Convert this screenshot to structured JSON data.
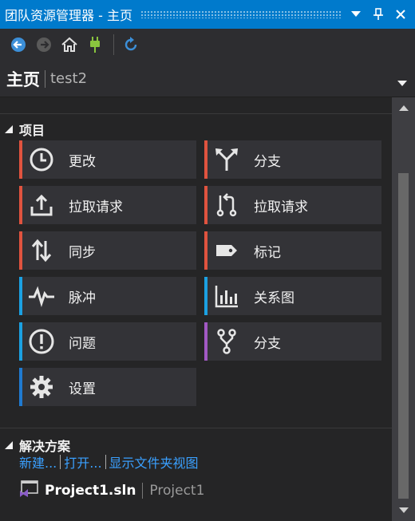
{
  "window": {
    "title": "团队资源管理器 - 主页"
  },
  "toolbar": {
    "back": "back-arrow-icon",
    "forward": "forward-arrow-icon",
    "home": "home-icon",
    "connect": "plug-icon",
    "refresh": "refresh-icon"
  },
  "header": {
    "title": "主页",
    "subtitle": "test2"
  },
  "project_section": {
    "title": "项目",
    "tiles": [
      {
        "label": "更改",
        "icon": "clock-icon",
        "bar_color": "#e0533f"
      },
      {
        "label": "分支",
        "icon": "branch-icon",
        "bar_color": "#e0533f"
      },
      {
        "label": "拉取请求",
        "icon": "upload-tray-icon",
        "bar_color": "#e0533f"
      },
      {
        "label": "拉取请求",
        "icon": "pull-request-icon",
        "bar_color": "#e0533f"
      },
      {
        "label": "同步",
        "icon": "sync-arrows-icon",
        "bar_color": "#e0533f"
      },
      {
        "label": "标记",
        "icon": "tag-icon",
        "bar_color": "#e0533f"
      },
      {
        "label": "脉冲",
        "icon": "pulse-icon",
        "bar_color": "#1ba1e2"
      },
      {
        "label": "关系图",
        "icon": "bar-chart-icon",
        "bar_color": "#1ba1e2"
      },
      {
        "label": "问题",
        "icon": "alert-circle-icon",
        "bar_color": "#1ba1e2"
      },
      {
        "label": "分支",
        "icon": "git-fork-icon",
        "bar_color": "#a259c4"
      },
      {
        "label": "设置",
        "icon": "gear-icon",
        "bar_color": "#1f7ad1"
      }
    ]
  },
  "solution_section": {
    "title": "解决方案",
    "links": {
      "new": "新建...",
      "open": "打开...",
      "show_folder_view": "显示文件夹视图"
    },
    "project": {
      "name": "Project1.sln",
      "subtitle": "Project1"
    }
  },
  "colors": {
    "accent": "#007acc",
    "link": "#3aa0ff",
    "background": "#252526"
  }
}
